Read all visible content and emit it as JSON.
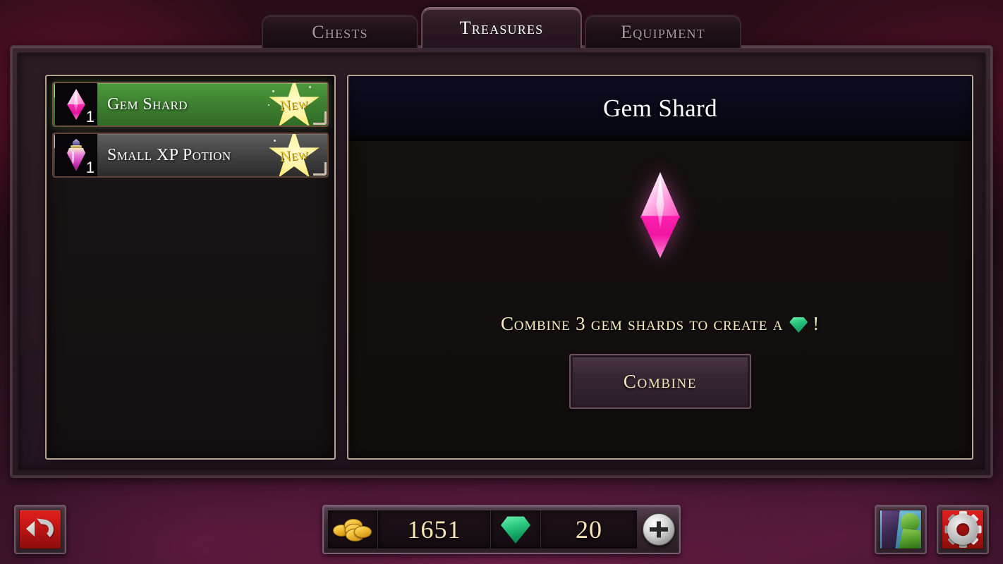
{
  "tabs": [
    {
      "label": "Chests",
      "active": false
    },
    {
      "label": "Treasures",
      "active": true
    },
    {
      "label": "Equipment",
      "active": false
    }
  ],
  "item_list": {
    "items": [
      {
        "name": "Gem Shard",
        "quantity": "1",
        "badge": "New",
        "icon": "gem-shard-icon",
        "selected": true
      },
      {
        "name": "Small XP Potion",
        "quantity": "1",
        "badge": "New",
        "icon": "xp-potion-icon",
        "selected": false
      }
    ]
  },
  "detail": {
    "title": "Gem Shard",
    "icon": "gem-shard-icon",
    "description_before": "Combine 3 gem shards to create a",
    "description_after": "!",
    "description_gem_icon": "emerald-gem-icon",
    "combine_label": "Combine"
  },
  "currency": {
    "gold_icon": "gold-coins-icon",
    "gold_value": "1651",
    "gem_icon": "emerald-gem-icon",
    "gem_value": "20",
    "add_icon": "plus-icon"
  },
  "bottom_nav": {
    "back_icon": "back-arrow-icon",
    "avatar_icon": "player-avatar-icon",
    "settings_icon": "gear-icon"
  },
  "colors": {
    "selected_row": "#3d8030",
    "unselected_row": "#454545",
    "badge_star": "#ffe86a",
    "accent_text": "#f6eec0",
    "title_bar": "#0d0d21",
    "gem_pink": "#ff2bb0",
    "emerald": "#2ecb82",
    "gold": "#f2bb33",
    "button_red": "#c01414"
  }
}
